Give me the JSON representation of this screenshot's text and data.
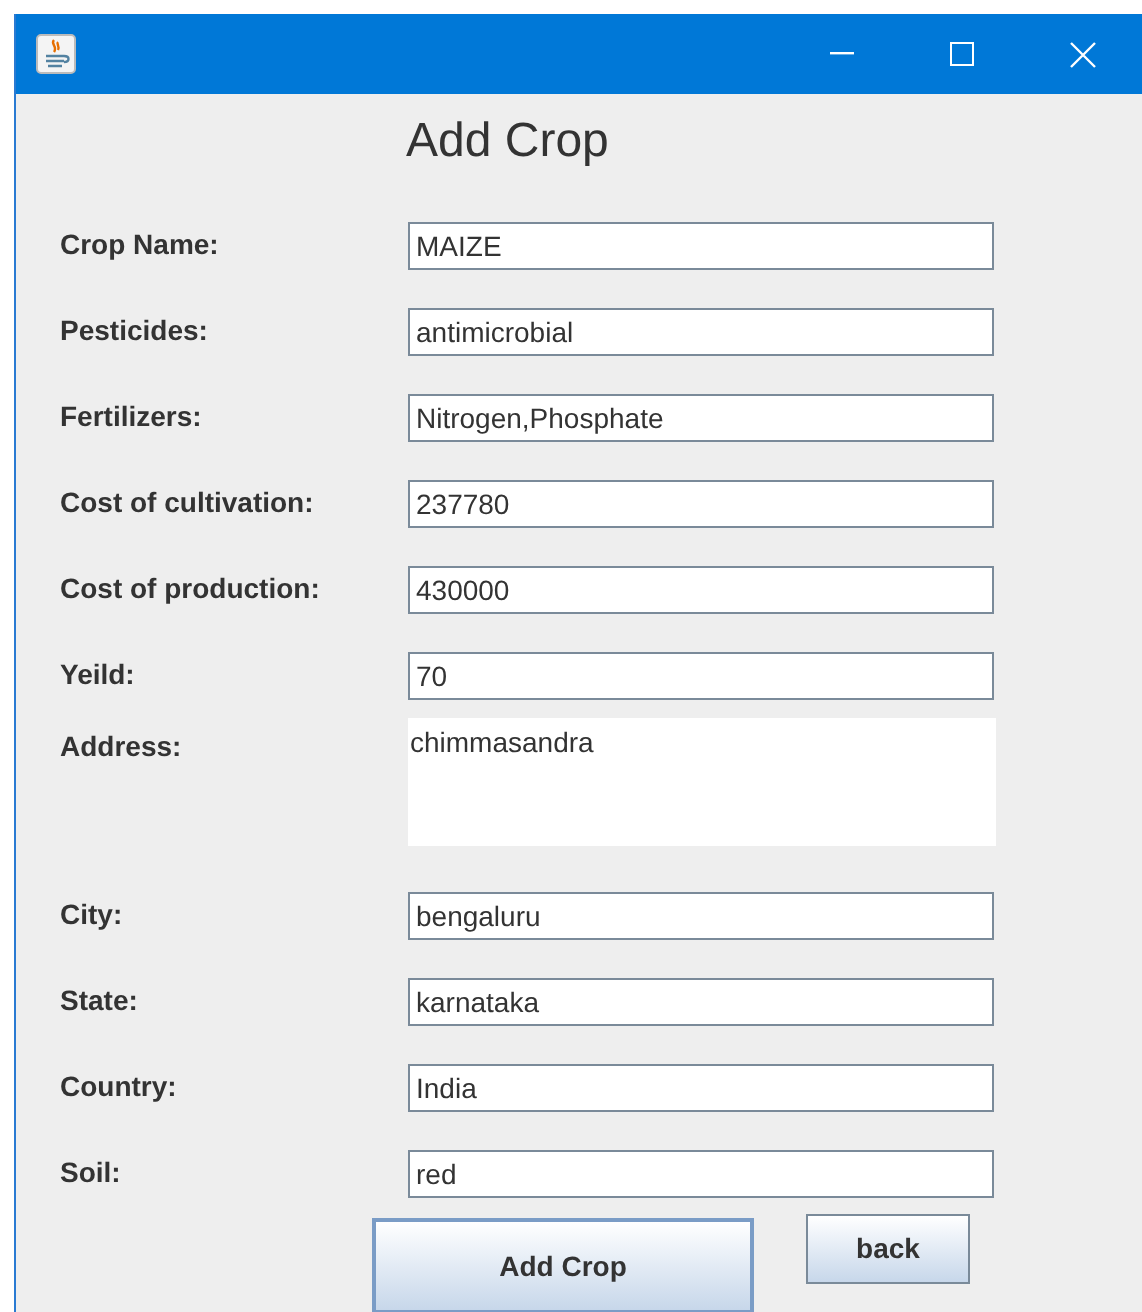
{
  "window": {
    "buttons": [
      {
        "kind": "minimize"
      },
      {
        "kind": "maximize"
      },
      {
        "kind": "close"
      }
    ]
  },
  "heading": "Add Crop",
  "fields": [
    {
      "label": "Crop Name:",
      "value": "MAIZE",
      "kind": "text"
    },
    {
      "label": "Pesticides:",
      "value": "antimicrobial",
      "kind": "text"
    },
    {
      "label": "Fertilizers:",
      "value": "Nitrogen,Phosphate",
      "kind": "text"
    },
    {
      "label": "Cost of cultivation:",
      "value": "237780",
      "kind": "text"
    },
    {
      "label": "Cost of production:",
      "value": "430000",
      "kind": "text"
    },
    {
      "label": "Yeild:",
      "value": "70",
      "kind": "text"
    },
    {
      "label": "Address:",
      "value": "chimmasandra",
      "kind": "area"
    },
    {
      "label": "City:",
      "value": "bengaluru",
      "kind": "text"
    },
    {
      "label": "State:",
      "value": "karnataka",
      "kind": "text"
    },
    {
      "label": "Country:",
      "value": "India",
      "kind": "text"
    },
    {
      "label": "Soil:",
      "value": "red",
      "kind": "text"
    }
  ],
  "buttons": [
    {
      "label": "Add Crop",
      "kind": "primary"
    },
    {
      "label": "back",
      "kind": "secondary"
    }
  ]
}
